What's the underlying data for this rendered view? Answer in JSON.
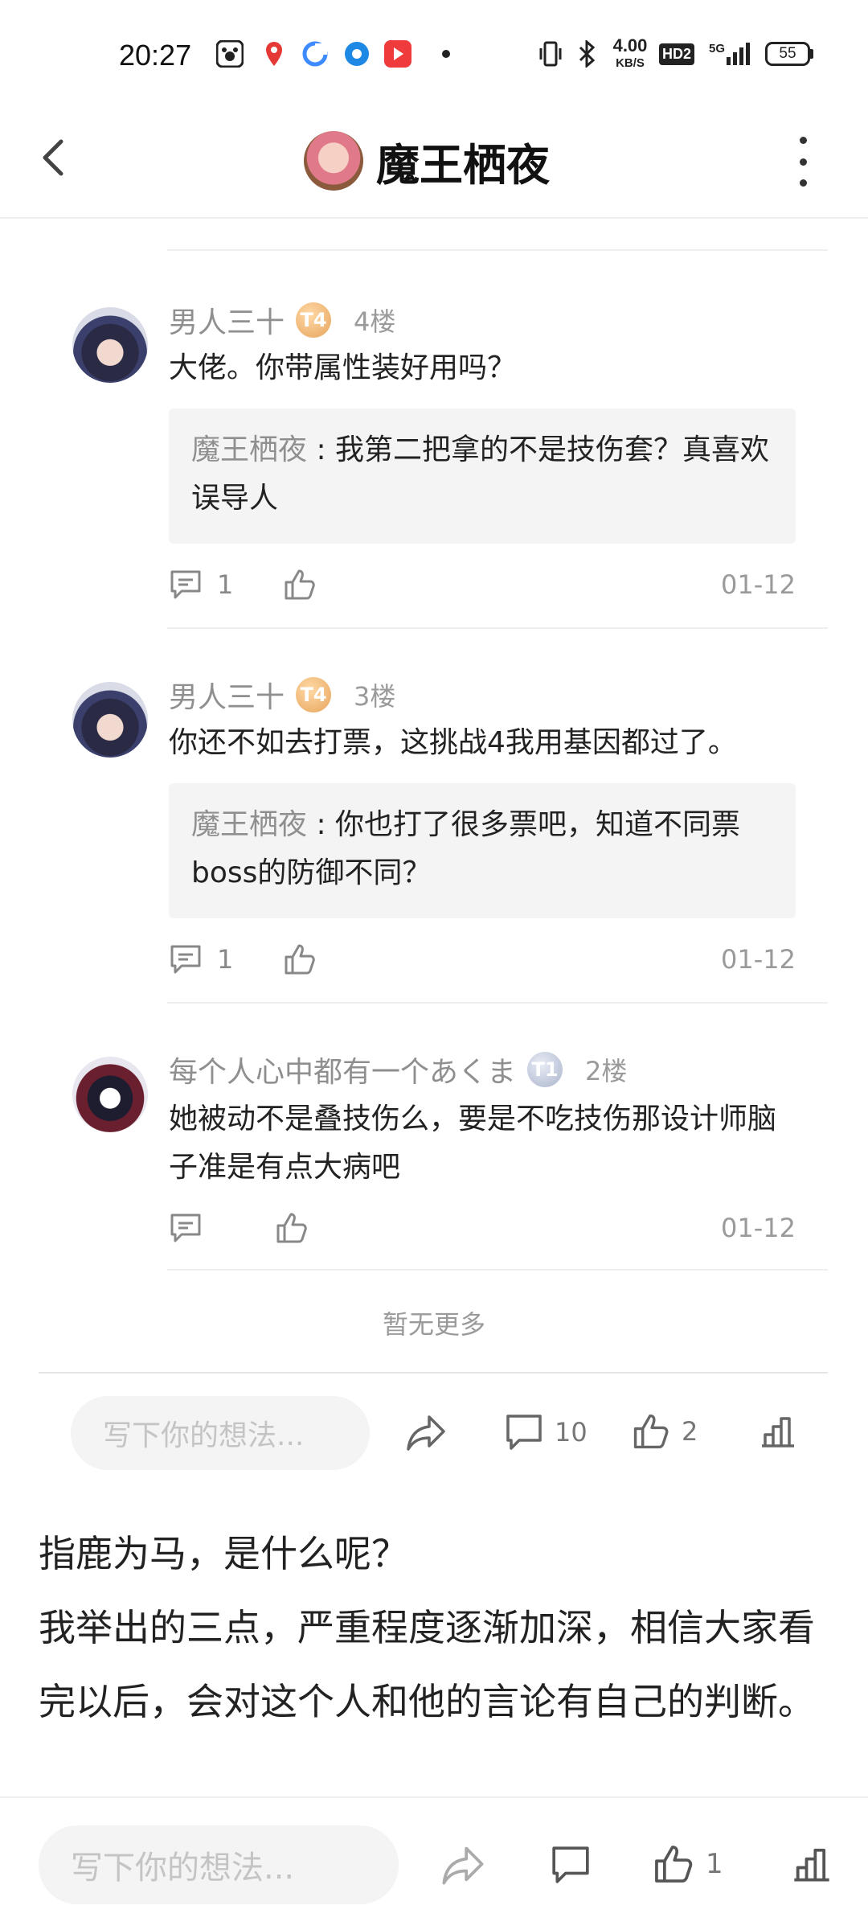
{
  "status_bar": {
    "time": "20:27",
    "network_speed_value": "4.00",
    "network_speed_unit": "KB/S",
    "hd_label": "HD2",
    "signal_label": "5G",
    "battery": "55"
  },
  "header": {
    "title": "魔王栖夜"
  },
  "comments": [
    {
      "user": "男人三十",
      "badge": "T4",
      "floor": "4楼",
      "text": "大佬。你带属性装好用吗？",
      "quote_user": "魔王栖夜",
      "quote_sep": " : ",
      "quote_text": "我第二把拿的不是技伤套？真喜欢误导人",
      "reply_count": "1",
      "date": "01-12"
    },
    {
      "user": "男人三十",
      "badge": "T4",
      "floor": "3楼",
      "text": "你还不如去打票，这挑战4我用基因都过了。",
      "quote_user": "魔王栖夜",
      "quote_sep": " : ",
      "quote_text": "你也打了很多票吧，知道不同票boss的防御不同？",
      "reply_count": "1",
      "date": "01-12"
    },
    {
      "user": "每个人心中都有一个あくま",
      "badge": "T1",
      "floor": "2楼",
      "text": "她被动不是叠技伤么，要是不吃技伤那设计师脑子准是有点大病吧",
      "date": "01-12"
    }
  ],
  "no_more": "暂无更多",
  "inner_bar": {
    "placeholder": "写下你的想法...",
    "comment_count": "10",
    "like_count": "2"
  },
  "article": {
    "line1": "指鹿为马，是什么呢？",
    "line2": "我举出的三点，严重程度逐渐加深，相信大家看完以后，会对这个人和他的言论有自己的判断。"
  },
  "bottom_bar": {
    "placeholder": "写下你的想法...",
    "like_count": "1"
  },
  "colors": {
    "gray_text": "#8f8f8f",
    "quote_bg": "#f4f4f4",
    "divider": "#eeeeee"
  }
}
